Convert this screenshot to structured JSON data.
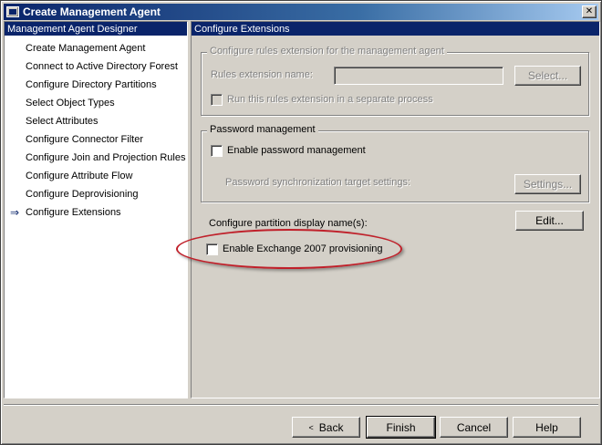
{
  "window": {
    "title": "Create Management Agent"
  },
  "left_pane": {
    "header": "Management Agent Designer",
    "items": [
      "Create Management Agent",
      "Connect to Active Directory Forest",
      "Configure Directory Partitions",
      "Select Object Types",
      "Select Attributes",
      "Configure Connector Filter",
      "Configure Join and Projection Rules",
      "Configure Attribute Flow",
      "Configure Deprovisioning",
      "Configure Extensions"
    ]
  },
  "right_pane": {
    "header": "Configure Extensions",
    "rules_group": {
      "legend": "Configure rules extension for the management agent",
      "name_label": "Rules extension name:",
      "name_value": "",
      "select_button": "Select...",
      "separate_process_label": "Run this rules extension in a separate process"
    },
    "password_group": {
      "legend": "Password management",
      "enable_label": "Enable password management",
      "sync_label": "Password synchronization target settings:",
      "settings_button": "Settings..."
    },
    "partition_label": "Configure partition display name(s):",
    "edit_button": "Edit...",
    "exchange_label": "Enable Exchange 2007 provisioning"
  },
  "buttons": {
    "back": "Back",
    "finish": "Finish",
    "cancel": "Cancel",
    "help": "Help"
  },
  "colors": {
    "highlight_ellipse": "#c0202a",
    "selected_header": "#0a246a"
  }
}
